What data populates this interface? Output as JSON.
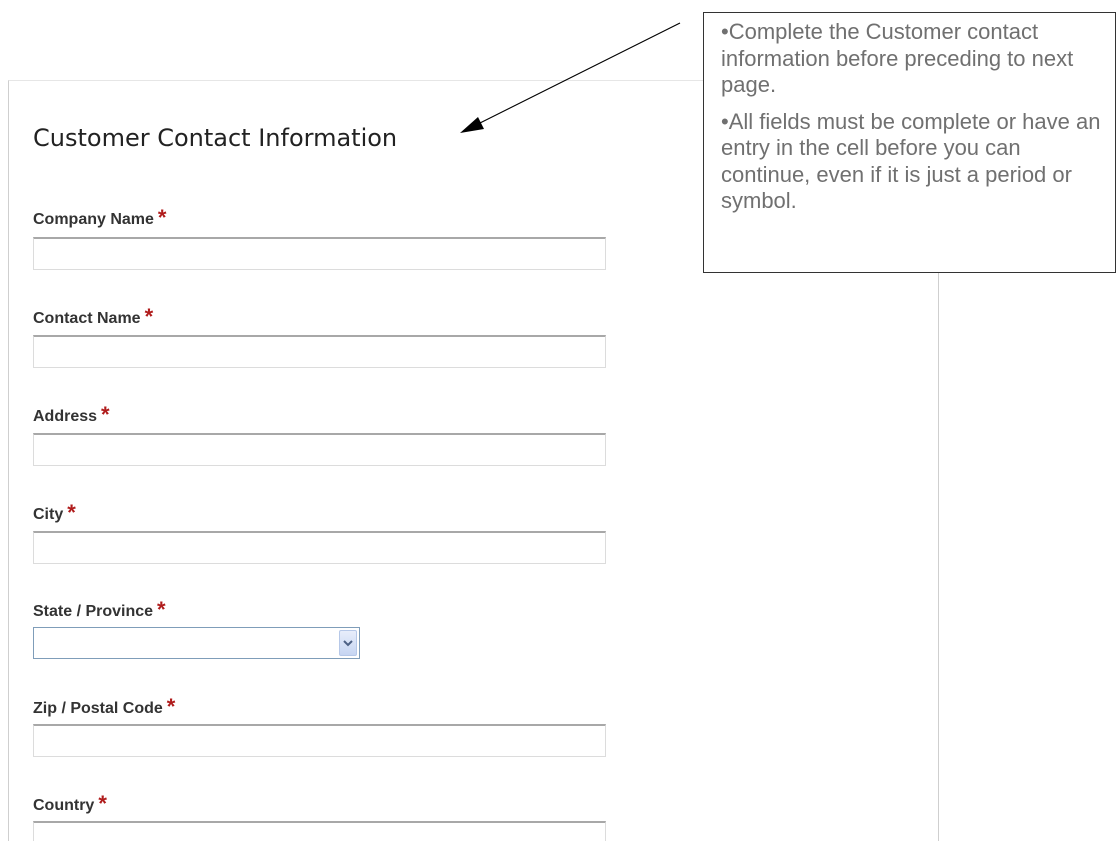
{
  "form": {
    "title": "Customer Contact Information",
    "required_marker": "*",
    "fields": [
      {
        "label": "Company Name",
        "value": "",
        "type": "text"
      },
      {
        "label": "Contact Name",
        "value": "",
        "type": "text"
      },
      {
        "label": "Address",
        "value": "",
        "type": "text"
      },
      {
        "label": "City",
        "value": "",
        "type": "text"
      },
      {
        "label": "State / Province",
        "value": "",
        "type": "select"
      },
      {
        "label": "Zip / Postal Code",
        "value": "",
        "type": "text"
      },
      {
        "label": "Country",
        "value": "",
        "type": "text"
      }
    ]
  },
  "callout": {
    "bullets": [
      "•Complete the Customer contact information before preceding to next page.",
      "•All fields must be complete or have an entry in the cell before you can continue, even if it is just a period or symbol."
    ]
  },
  "colors": {
    "required": "#b01c1c",
    "callout_text": "#707070",
    "field_border": "#a8a8a8"
  },
  "icons": {
    "dropdown": "chevron-down-icon",
    "annotation_arrow": "arrow-icon"
  }
}
